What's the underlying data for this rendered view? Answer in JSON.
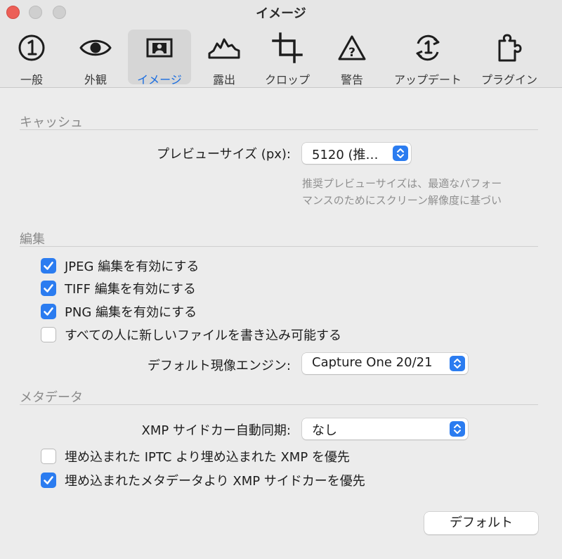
{
  "window": {
    "title": "イメージ"
  },
  "tabs": [
    {
      "label": "一般",
      "icon": "number-one-circle-icon"
    },
    {
      "label": "外観",
      "icon": "eye-icon"
    },
    {
      "label": "イメージ",
      "icon": "image-frame-icon",
      "selected": true
    },
    {
      "label": "露出",
      "icon": "histogram-icon"
    },
    {
      "label": "クロップ",
      "icon": "crop-icon"
    },
    {
      "label": "警告",
      "icon": "warning-triangle-icon"
    },
    {
      "label": "アップデート",
      "icon": "update-icon"
    },
    {
      "label": "プラグイン",
      "icon": "puzzle-piece-icon"
    }
  ],
  "cache": {
    "section_title": "キャッシュ",
    "preview_label": "プレビューサイズ (px):",
    "preview_value": "5120 (推…",
    "hint_line1": "推奨プレビューサイズは、最適なパフォー",
    "hint_line2": "マンスのためにスクリーン解像度に基づい"
  },
  "edit": {
    "section_title": "編集",
    "checkboxes": [
      {
        "label": "JPEG 編集を有効にする",
        "checked": true
      },
      {
        "label": "TIFF 編集を有効にする",
        "checked": true
      },
      {
        "label": "PNG 編集を有効にする",
        "checked": true
      },
      {
        "label": "すべての人に新しいファイルを書き込み可能する",
        "checked": false
      }
    ],
    "engine_label": "デフォルト現像エンジン:",
    "engine_value": "Capture One 20/21"
  },
  "metadata": {
    "section_title": "メタデータ",
    "xmp_label": "XMP サイドカー自動同期:",
    "xmp_value": "なし",
    "checkboxes": [
      {
        "label": "埋め込まれた IPTC より埋め込まれた XMP を優先",
        "checked": false
      },
      {
        "label": "埋め込まれたメタデータより XMP サイドカーを優先",
        "checked": true
      }
    ]
  },
  "footer": {
    "default_button": "デフォルト"
  },
  "colors": {
    "accent": "#2b7cf0",
    "selected_tab_text": "#1a6de0",
    "close_button": "#ec5f57"
  }
}
